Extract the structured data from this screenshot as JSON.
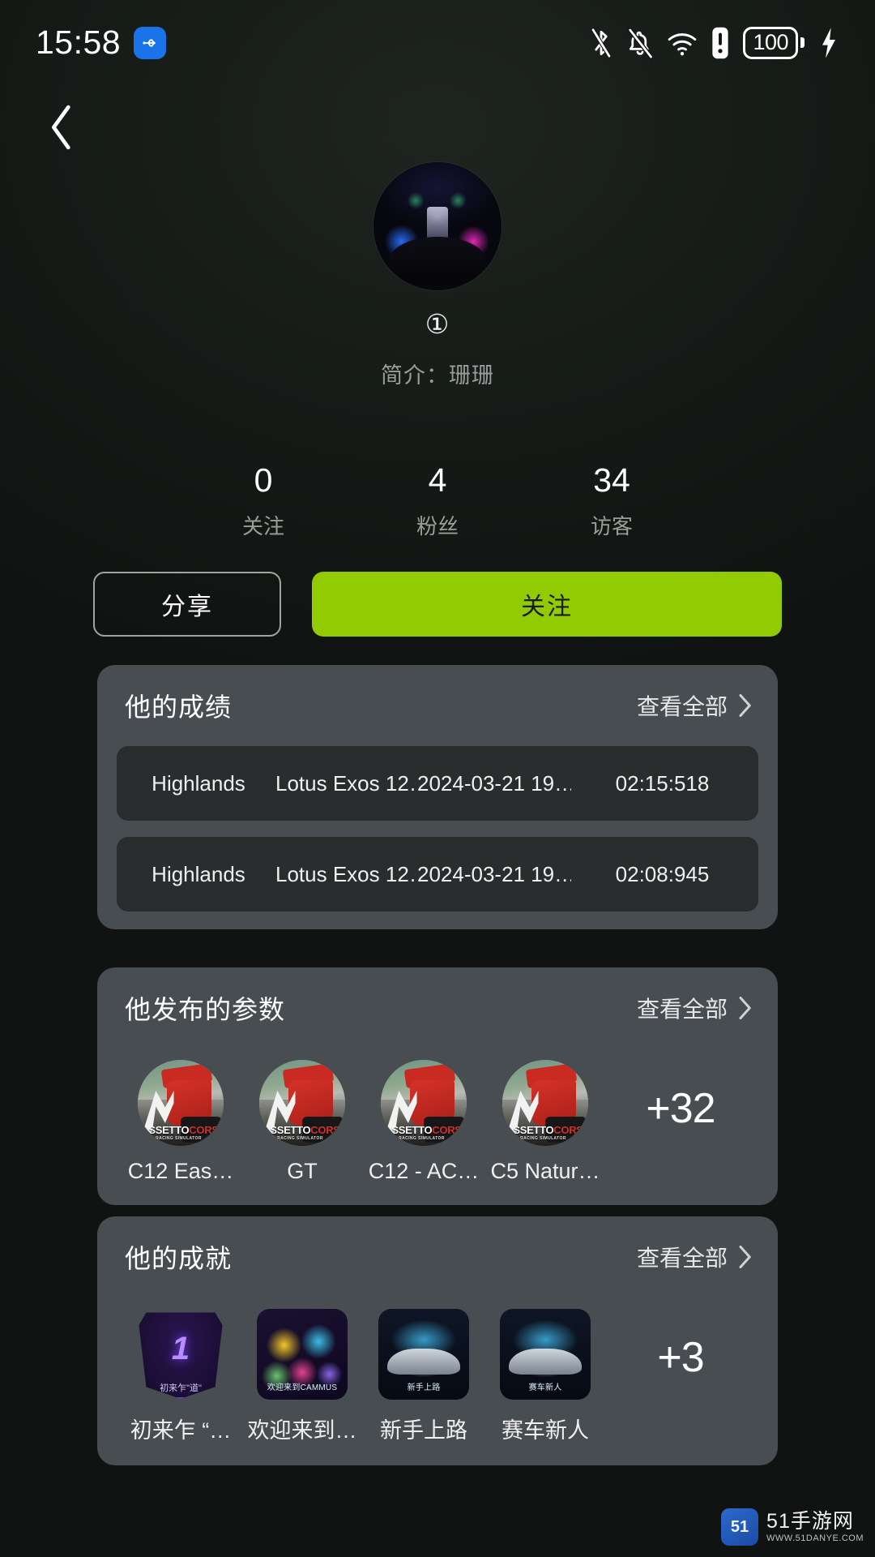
{
  "status_bar": {
    "time": "15:58",
    "usb_icon": "usb-icon",
    "battery_percent": "100",
    "icons": [
      "bluetooth-off-icon",
      "notification-muted-icon",
      "wifi-icon",
      "alert-icon",
      "battery-icon",
      "charging-bolt-icon"
    ]
  },
  "nav": {
    "back_icon": "back-chevron-icon"
  },
  "profile": {
    "avatar_alt": "user-avatar",
    "username": "①",
    "bio": "简介：珊珊"
  },
  "stats": [
    {
      "value": "0",
      "label": "关注"
    },
    {
      "value": "4",
      "label": "粉丝"
    },
    {
      "value": "34",
      "label": "访客"
    }
  ],
  "actions": {
    "share_label": "分享",
    "follow_label": "关注",
    "follow_color": "#93cb02"
  },
  "results_card": {
    "title": "他的成绩",
    "more_label": "查看全部",
    "rows": [
      {
        "track": "Highlands",
        "car": "Lotus Exos 12…",
        "date": "2024-03-21 19…",
        "time": "02:15:518"
      },
      {
        "track": "Highlands",
        "car": "Lotus Exos 12…",
        "date": "2024-03-21 19…",
        "time": "02:08:945"
      }
    ]
  },
  "params_card": {
    "title": "他发布的参数",
    "more_label": "查看全部",
    "overflow": "+32",
    "items": [
      {
        "label": "C12 Eas…",
        "icon": "assetto-corsa-icon"
      },
      {
        "label": "GT",
        "icon": "assetto-corsa-icon"
      },
      {
        "label": "C12 - AC…",
        "icon": "assetto-corsa-icon"
      },
      {
        "label": "C5 Natur…",
        "icon": "assetto-corsa-icon"
      }
    ]
  },
  "achievements_card": {
    "title": "他的成就",
    "more_label": "查看全部",
    "overflow": "+3",
    "items": [
      {
        "label": "初来乍 “…",
        "badge": "laurel-first-badge",
        "caption": "初来乍\"道\"",
        "number": "1"
      },
      {
        "label": "欢迎来到…",
        "badge": "welcome-rainbow-badge",
        "caption": "欢迎来到CAMMUS"
      },
      {
        "label": "新手上路",
        "badge": "rookie-car-badge",
        "caption": "新手上路"
      },
      {
        "label": "赛车新人",
        "badge": "racer-newbie-badge",
        "caption": "赛车新人"
      }
    ]
  },
  "watermark": {
    "main": "51手游网",
    "sub": "WWW.51DANYE.COM",
    "mark": "51"
  }
}
